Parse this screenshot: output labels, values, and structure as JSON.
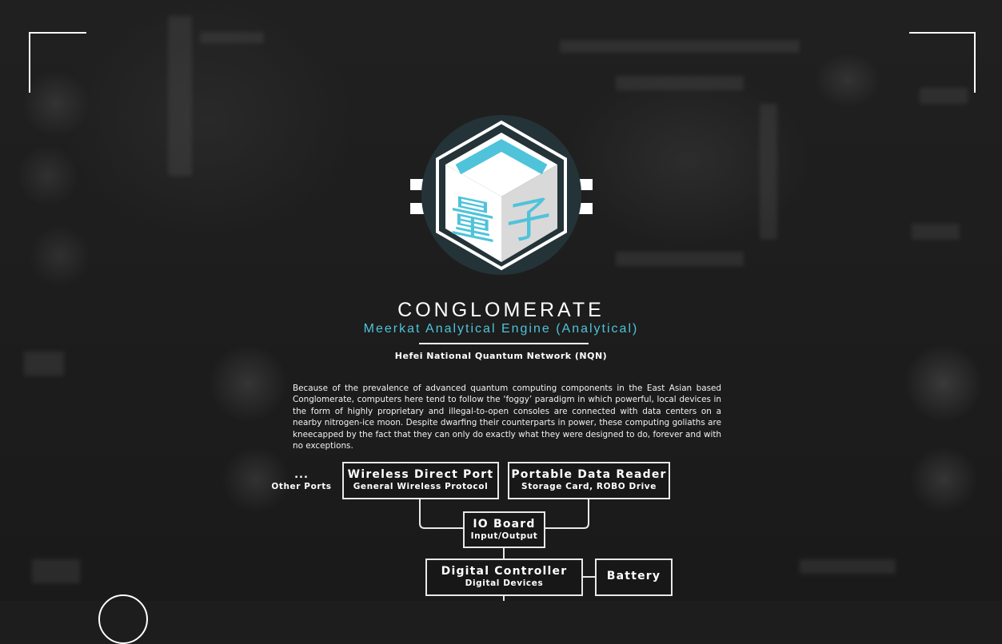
{
  "header": {
    "title": "CONGLOMERATE",
    "subtitle": "Meerkat Analytical Engine (Analytical)",
    "network": "Hefei National Quantum Network (NQN)"
  },
  "logo": {
    "glyph_left": "量",
    "glyph_right": "子",
    "accent_color": "#4fc3da"
  },
  "description": "Because of the prevalence of advanced quantum computing components in the East Asian based Conglomerate, computers here tend to follow the ‘foggy’ paradigm in which powerful, local devices in the form of highly proprietary and illegal-to-open consoles are connected with data centers on a nearby nitrogen-ice moon. Despite dwarfing their counterparts in power, these computing goliaths are kneecapped by the fact that they can only do exactly what they were designed to do, forever and with no exceptions.",
  "diagram": {
    "other_ports": {
      "label": "...",
      "sub": "Other Ports"
    },
    "wireless": {
      "label": "Wireless Direct Port",
      "sub": "General Wireless Protocol"
    },
    "reader": {
      "label": "Portable Data Reader",
      "sub": "Storage Card, ROBO Drive"
    },
    "io_board": {
      "label": "IO Board",
      "sub": "Input/Output"
    },
    "controller": {
      "label": "Digital Controller",
      "sub": "Digital Devices"
    },
    "battery": {
      "label": "Battery"
    }
  }
}
